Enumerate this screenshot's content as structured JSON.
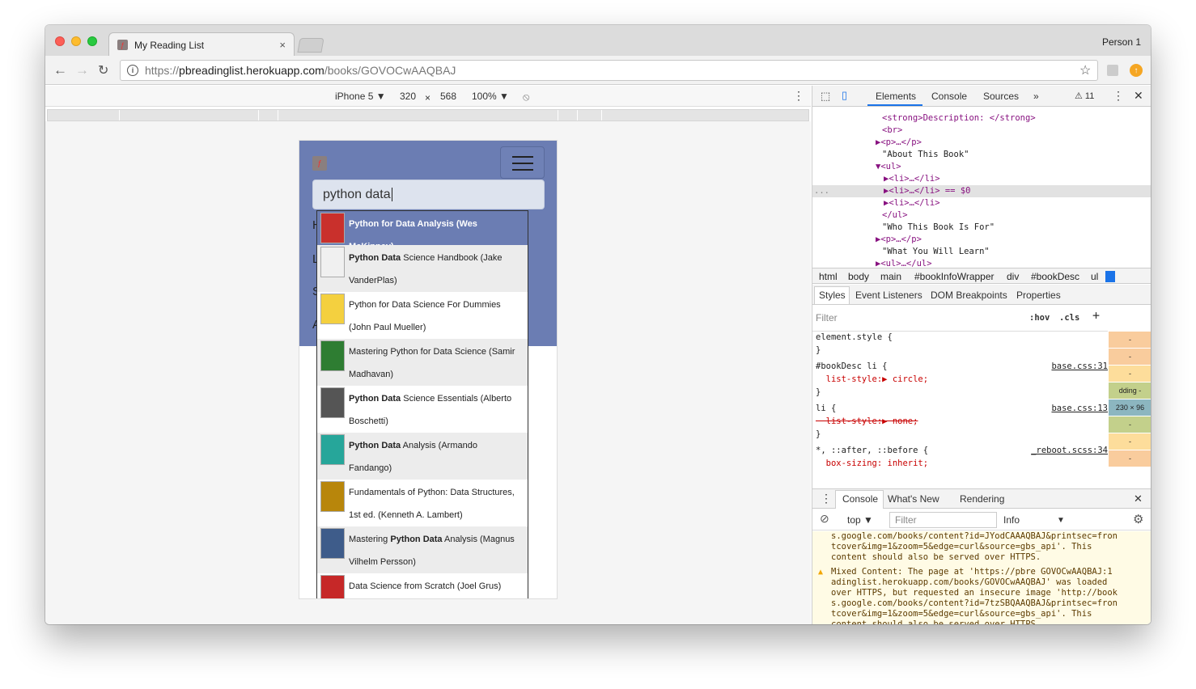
{
  "browser": {
    "tab_title": "My Reading List",
    "tab_close": "×",
    "person": "Person 1",
    "url_scheme": "https://",
    "url_host": "pbreadinglist.herokuapp.com",
    "url_path": "/books/GOVOCwAAQBAJ"
  },
  "device_toolbar": {
    "device": "iPhone 5 ▼",
    "width": "320",
    "times": "×",
    "height": "568",
    "zoom": "100% ▼",
    "menu": "⋮"
  },
  "page": {
    "search_value": "python data",
    "menu_letters": [
      "H",
      "L",
      "S",
      "A"
    ],
    "suggestions": [
      {
        "pre": "",
        "bold": "Python for Data Analysis (Wes McKinney)",
        "post": "",
        "cont": ""
      },
      {
        "pre": "",
        "bold": "Python Data",
        "post": " Science Handbook (Jake",
        "cont": "VanderPlas)"
      },
      {
        "pre": "Python for Data Science For Dummies",
        "bold": "",
        "post": "",
        "cont": "(John Paul Mueller)"
      },
      {
        "pre": "Mastering Python for Data Science (Samir",
        "bold": "",
        "post": "",
        "cont": "Madhavan)"
      },
      {
        "pre": "",
        "bold": "Python Data",
        "post": " Science Essentials (Alberto",
        "cont": "Boschetti)"
      },
      {
        "pre": "",
        "bold": "Python Data",
        "post": " Analysis (Armando",
        "cont": "Fandango)"
      },
      {
        "pre": "Fundamentals of Python: Data Structures,",
        "bold": "",
        "post": "",
        "cont": "1st ed. (Kenneth A. Lambert)"
      },
      {
        "pre": "Mastering ",
        "bold": "Python Data",
        "post": " Analysis (Magnus",
        "cont": "Vilhelm Persson)"
      },
      {
        "pre": "Data Science from Scratch (Joel Grus)",
        "bold": "",
        "post": "",
        "cont": ""
      }
    ]
  },
  "devtools": {
    "tabs": [
      "Elements",
      "Console",
      "Sources",
      "»"
    ],
    "warnings": "⚠ 11",
    "elements_lines": [
      "<strong>Description: </strong>",
      "<br>",
      "▶<p>…</p>",
      "\"About This Book\"",
      "▼<ul>",
      "▶<li>…</li>",
      "▶<li>…</li> == $0",
      "▶<li>…</li>",
      "</ul>",
      "\"Who This Book Is For\"",
      "▶<p>…</p>",
      "\"What You Will Learn\"",
      "▶<ul>…</ul>"
    ],
    "selected_dots": "...",
    "breadcrumb": [
      "html",
      "body",
      "main",
      "#bookInfoWrapper",
      "div",
      "#bookDesc",
      "ul",
      "li"
    ],
    "styles_tabs": [
      "Styles",
      "Event Listeners",
      "DOM Breakpoints",
      "Properties"
    ],
    "filter": "Filter",
    "hov": ":hov",
    "cls": ".cls",
    "plus": "+",
    "rules": [
      {
        "text": "element.style {",
        "link": ""
      },
      {
        "text": "}",
        "link": ""
      },
      {
        "text": "#bookDesc li {",
        "link": "base.css:31"
      },
      {
        "text": "  list-style:▶ circle;",
        "link": ""
      },
      {
        "text": "}",
        "link": ""
      },
      {
        "text": "li {",
        "link": "base.css:13"
      },
      {
        "text": "  list-style:▶ none;",
        "link": ""
      },
      {
        "text": "}",
        "link": ""
      },
      {
        "text": "*, ::after, ::before {",
        "link": "_reboot.scss:34"
      },
      {
        "text": "  box-sizing: inherit;",
        "link": ""
      }
    ],
    "box_model": [
      "-",
      "-",
      "-",
      "dding -",
      "230 × 96",
      "-",
      "-",
      "-"
    ],
    "console_tabs": [
      "Console",
      "What's New",
      "Rendering"
    ],
    "console_context": "top ▼",
    "console_filter": "Filter",
    "console_level": "Info",
    "console_level_arrow": "▼",
    "console_lines": [
      "s.google.com/books/content?id=JYodCAAAQBAJ&printsec=fron",
      "tcover&img=1&zoom=5&edge=curl&source=gbs_api'. This",
      "content should also be served over HTTPS.",
      "Mixed Content: The page at 'https://pbre GOVOCwAAQBAJ:1",
      "adinglist.herokuapp.com/books/GOVOCwAAQBAJ' was loaded",
      "over HTTPS, but requested an insecure image 'http://book",
      "s.google.com/books/content?id=7tzSBQAAQBAJ&printsec=fron",
      "tcover&img=1&zoom=5&edge=curl&source=gbs_api'. This",
      "content should also be served over HTTPS."
    ],
    "prompt": "›"
  },
  "colors": {
    "nav": "#6b7db3",
    "accent": "#1a73e8",
    "warning_bg": "#fffbe5"
  }
}
